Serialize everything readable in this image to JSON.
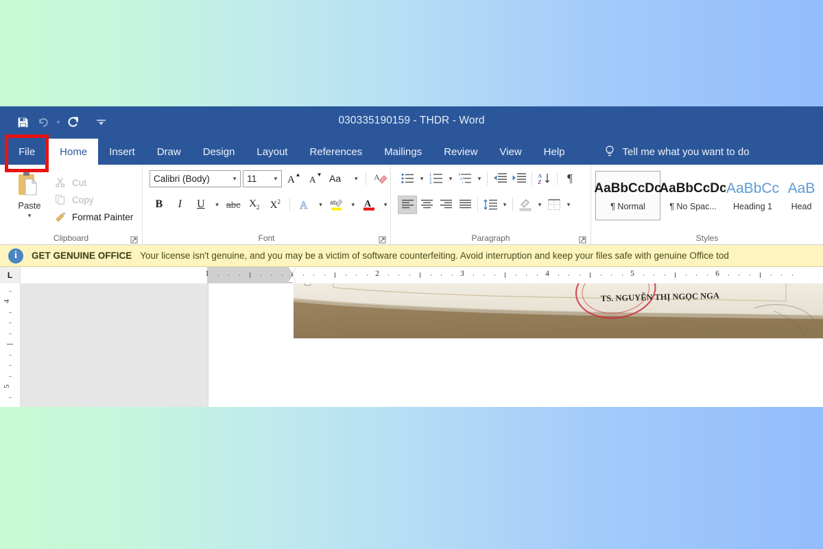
{
  "window": {
    "title": "030335190159 - THDR  -  Word"
  },
  "quick_access": {
    "items": [
      {
        "name": "save",
        "icon": "save-icon",
        "enabled": true
      },
      {
        "name": "undo",
        "icon": "undo-icon",
        "enabled": false
      },
      {
        "name": "redo",
        "icon": "redo-icon",
        "enabled": true
      },
      {
        "name": "customize",
        "icon": "chevron-down-icon",
        "enabled": true
      }
    ]
  },
  "ribbon": {
    "tabs": [
      {
        "label": "File",
        "active": false,
        "highlighted": true
      },
      {
        "label": "Home",
        "active": true,
        "highlighted": false
      },
      {
        "label": "Insert",
        "active": false,
        "highlighted": false
      },
      {
        "label": "Draw",
        "active": false,
        "highlighted": false
      },
      {
        "label": "Design",
        "active": false,
        "highlighted": false
      },
      {
        "label": "Layout",
        "active": false,
        "highlighted": false
      },
      {
        "label": "References",
        "active": false,
        "highlighted": false
      },
      {
        "label": "Mailings",
        "active": false,
        "highlighted": false
      },
      {
        "label": "Review",
        "active": false,
        "highlighted": false
      },
      {
        "label": "View",
        "active": false,
        "highlighted": false
      },
      {
        "label": "Help",
        "active": false,
        "highlighted": false
      }
    ],
    "tell_me": "Tell me what you want to do",
    "highlight_color": "#e81313",
    "accent_color": "#2b579a"
  },
  "clipboard": {
    "group_label": "Clipboard",
    "paste_label": "Paste",
    "cut_label": "Cut",
    "copy_label": "Copy",
    "format_painter_label": "Format Painter"
  },
  "font": {
    "group_label": "Font",
    "font_name": "Calibri (Body)",
    "font_size": "11",
    "grow_label": "A",
    "shrink_label": "A",
    "change_case_label": "Aa",
    "bold_label": "B",
    "italic_label": "I",
    "underline_label": "U",
    "strikethrough_label": "abc",
    "subscript_label": "X",
    "subscript_sub": "2",
    "superscript_label": "X",
    "superscript_sup": "2",
    "text_effects_label": "A",
    "highlight_label": "ab",
    "font_color_label": "A"
  },
  "paragraph": {
    "group_label": "Paragraph"
  },
  "styles": {
    "group_label": "Styles",
    "items": [
      {
        "preview": "AaBbCcDc",
        "name": "¶ Normal",
        "active": true,
        "kind": "body"
      },
      {
        "preview": "AaBbCcDc",
        "name": "¶ No Spac...",
        "active": false,
        "kind": "body"
      },
      {
        "preview": "AaBbCc",
        "name": "Heading 1",
        "active": false,
        "kind": "heading"
      },
      {
        "preview": "AaB",
        "name": "Head",
        "active": false,
        "kind": "heading"
      }
    ]
  },
  "license_banner": {
    "headline": "GET GENUINE OFFICE",
    "message": "Your license isn't genuine, and you may be a victim of software counterfeiting. Avoid interruption and keep your files safe with genuine Office tod",
    "icon": "info-icon",
    "background": "#fdf4bf"
  },
  "ruler": {
    "tab_stop_selector": "L",
    "horizontal_labels": [
      "1",
      "1",
      "2",
      "3",
      "4",
      "5",
      "6"
    ],
    "vertical_labels": [
      "4",
      "5"
    ]
  },
  "document": {
    "image_caption": "TS. NGUYỄN THỊ NGỌC NGA",
    "selected": true
  }
}
